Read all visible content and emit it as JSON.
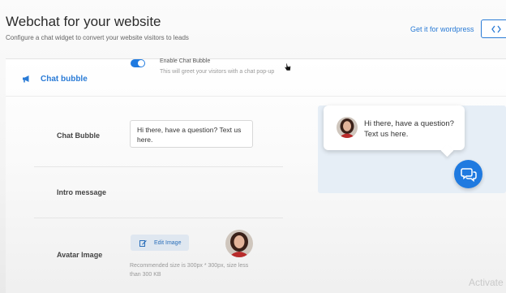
{
  "header": {
    "title": "Webchat for your website",
    "subtitle": "Configure a chat widget to convert your website visitors to leads",
    "wordpress_link": "Get it for wordpress",
    "code_button_icon": "code-icon"
  },
  "settings": {
    "tab_label": "Chat bubble",
    "tab_icon": "megaphone-icon",
    "chat_bubble": {
      "label": "Chat Bubble",
      "enabled": true,
      "toggle_title": "Enable Chat Bubble",
      "toggle_description": "This will greet your visitors with a chat pop-up"
    },
    "intro_message": {
      "label": "Intro message",
      "value": "Hi there, have a question? Text us here."
    },
    "avatar_image": {
      "label": "Avatar Image",
      "edit_button": "Edit Image",
      "edit_icon": "edit-icon",
      "recommendation": "Recommended size is 300px * 300px, size less than 300 KB"
    }
  },
  "preview": {
    "bubble_text": "Hi there, have a question? Text us here.",
    "fab_icon": "chat-bubbles-icon"
  },
  "watermark": "Activate",
  "colors": {
    "accent": "#2a7bd6",
    "toggle": "#1f7ae0",
    "preview_bg": "#e6eef6"
  }
}
